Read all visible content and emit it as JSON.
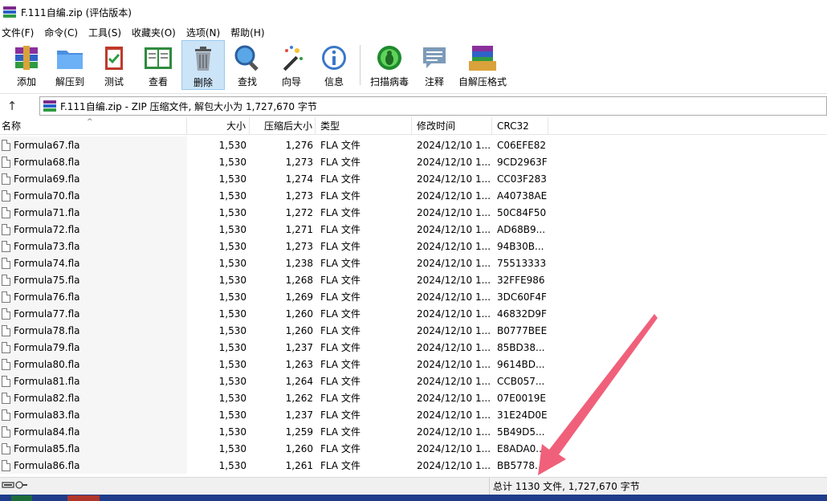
{
  "window": {
    "title": "F.111自编.zip (评估版本)"
  },
  "menu": [
    "文件(F)",
    "命令(C)",
    "工具(S)",
    "收藏夹(O)",
    "选项(N)",
    "帮助(H)"
  ],
  "toolbar": {
    "add": "添加",
    "extract": "解压到",
    "test": "测试",
    "view": "查看",
    "delete": "删除",
    "find": "查找",
    "wizard": "向导",
    "info": "信息",
    "virus_scan": "扫描病毒",
    "comment": "注释",
    "sfx": "自解压格式"
  },
  "address": {
    "text": "F.111自编.zip - ZIP 压缩文件, 解包大小为 1,727,670 字节"
  },
  "columns": {
    "name": "名称",
    "size": "大小",
    "packed": "压缩后大小",
    "type": "类型",
    "modified": "修改时间",
    "crc": "CRC32"
  },
  "files": [
    {
      "name": "Formula67.fla",
      "size": "1,530",
      "packed": "1,276",
      "type": "FLA 文件",
      "modified": "2024/12/10 1...",
      "crc": "C06EFE82"
    },
    {
      "name": "Formula68.fla",
      "size": "1,530",
      "packed": "1,273",
      "type": "FLA 文件",
      "modified": "2024/12/10 1...",
      "crc": "9CD2963F"
    },
    {
      "name": "Formula69.fla",
      "size": "1,530",
      "packed": "1,274",
      "type": "FLA 文件",
      "modified": "2024/12/10 1...",
      "crc": "CC03F283"
    },
    {
      "name": "Formula70.fla",
      "size": "1,530",
      "packed": "1,273",
      "type": "FLA 文件",
      "modified": "2024/12/10 1...",
      "crc": "A40738AE"
    },
    {
      "name": "Formula71.fla",
      "size": "1,530",
      "packed": "1,272",
      "type": "FLA 文件",
      "modified": "2024/12/10 1...",
      "crc": "50C84F50"
    },
    {
      "name": "Formula72.fla",
      "size": "1,530",
      "packed": "1,271",
      "type": "FLA 文件",
      "modified": "2024/12/10 1...",
      "crc": "AD68B9..."
    },
    {
      "name": "Formula73.fla",
      "size": "1,530",
      "packed": "1,273",
      "type": "FLA 文件",
      "modified": "2024/12/10 1...",
      "crc": "94B30B..."
    },
    {
      "name": "Formula74.fla",
      "size": "1,530",
      "packed": "1,238",
      "type": "FLA 文件",
      "modified": "2024/12/10 1...",
      "crc": "75513333"
    },
    {
      "name": "Formula75.fla",
      "size": "1,530",
      "packed": "1,268",
      "type": "FLA 文件",
      "modified": "2024/12/10 1...",
      "crc": "32FFE986"
    },
    {
      "name": "Formula76.fla",
      "size": "1,530",
      "packed": "1,269",
      "type": "FLA 文件",
      "modified": "2024/12/10 1...",
      "crc": "3DC60F4F"
    },
    {
      "name": "Formula77.fla",
      "size": "1,530",
      "packed": "1,260",
      "type": "FLA 文件",
      "modified": "2024/12/10 1...",
      "crc": "46832D9F"
    },
    {
      "name": "Formula78.fla",
      "size": "1,530",
      "packed": "1,260",
      "type": "FLA 文件",
      "modified": "2024/12/10 1...",
      "crc": "B0777BEE"
    },
    {
      "name": "Formula79.fla",
      "size": "1,530",
      "packed": "1,237",
      "type": "FLA 文件",
      "modified": "2024/12/10 1...",
      "crc": "85BD38..."
    },
    {
      "name": "Formula80.fla",
      "size": "1,530",
      "packed": "1,263",
      "type": "FLA 文件",
      "modified": "2024/12/10 1...",
      "crc": "9614BD..."
    },
    {
      "name": "Formula81.fla",
      "size": "1,530",
      "packed": "1,264",
      "type": "FLA 文件",
      "modified": "2024/12/10 1...",
      "crc": "CCB057..."
    },
    {
      "name": "Formula82.fla",
      "size": "1,530",
      "packed": "1,262",
      "type": "FLA 文件",
      "modified": "2024/12/10 1...",
      "crc": "07E0019E"
    },
    {
      "name": "Formula83.fla",
      "size": "1,530",
      "packed": "1,237",
      "type": "FLA 文件",
      "modified": "2024/12/10 1...",
      "crc": "31E24D0E"
    },
    {
      "name": "Formula84.fla",
      "size": "1,530",
      "packed": "1,259",
      "type": "FLA 文件",
      "modified": "2024/12/10 1...",
      "crc": "5B49D5..."
    },
    {
      "name": "Formula85.fla",
      "size": "1,530",
      "packed": "1,260",
      "type": "FLA 文件",
      "modified": "2024/12/10 1...",
      "crc": "E8ADA0..."
    },
    {
      "name": "Formula86.fla",
      "size": "1,530",
      "packed": "1,261",
      "type": "FLA 文件",
      "modified": "2024/12/10 1...",
      "crc": "BB5778..."
    }
  ],
  "status": {
    "summary": "总计 1130 文件, 1,727,670 字节"
  },
  "icons": {
    "sort": "sort-up-icon",
    "up": "arrow-up-icon",
    "file": "file-icon",
    "drive": "drive-icon"
  },
  "colors": {
    "annotation_arrow": "#f0607a",
    "taskbar": "#1f3d8a"
  }
}
